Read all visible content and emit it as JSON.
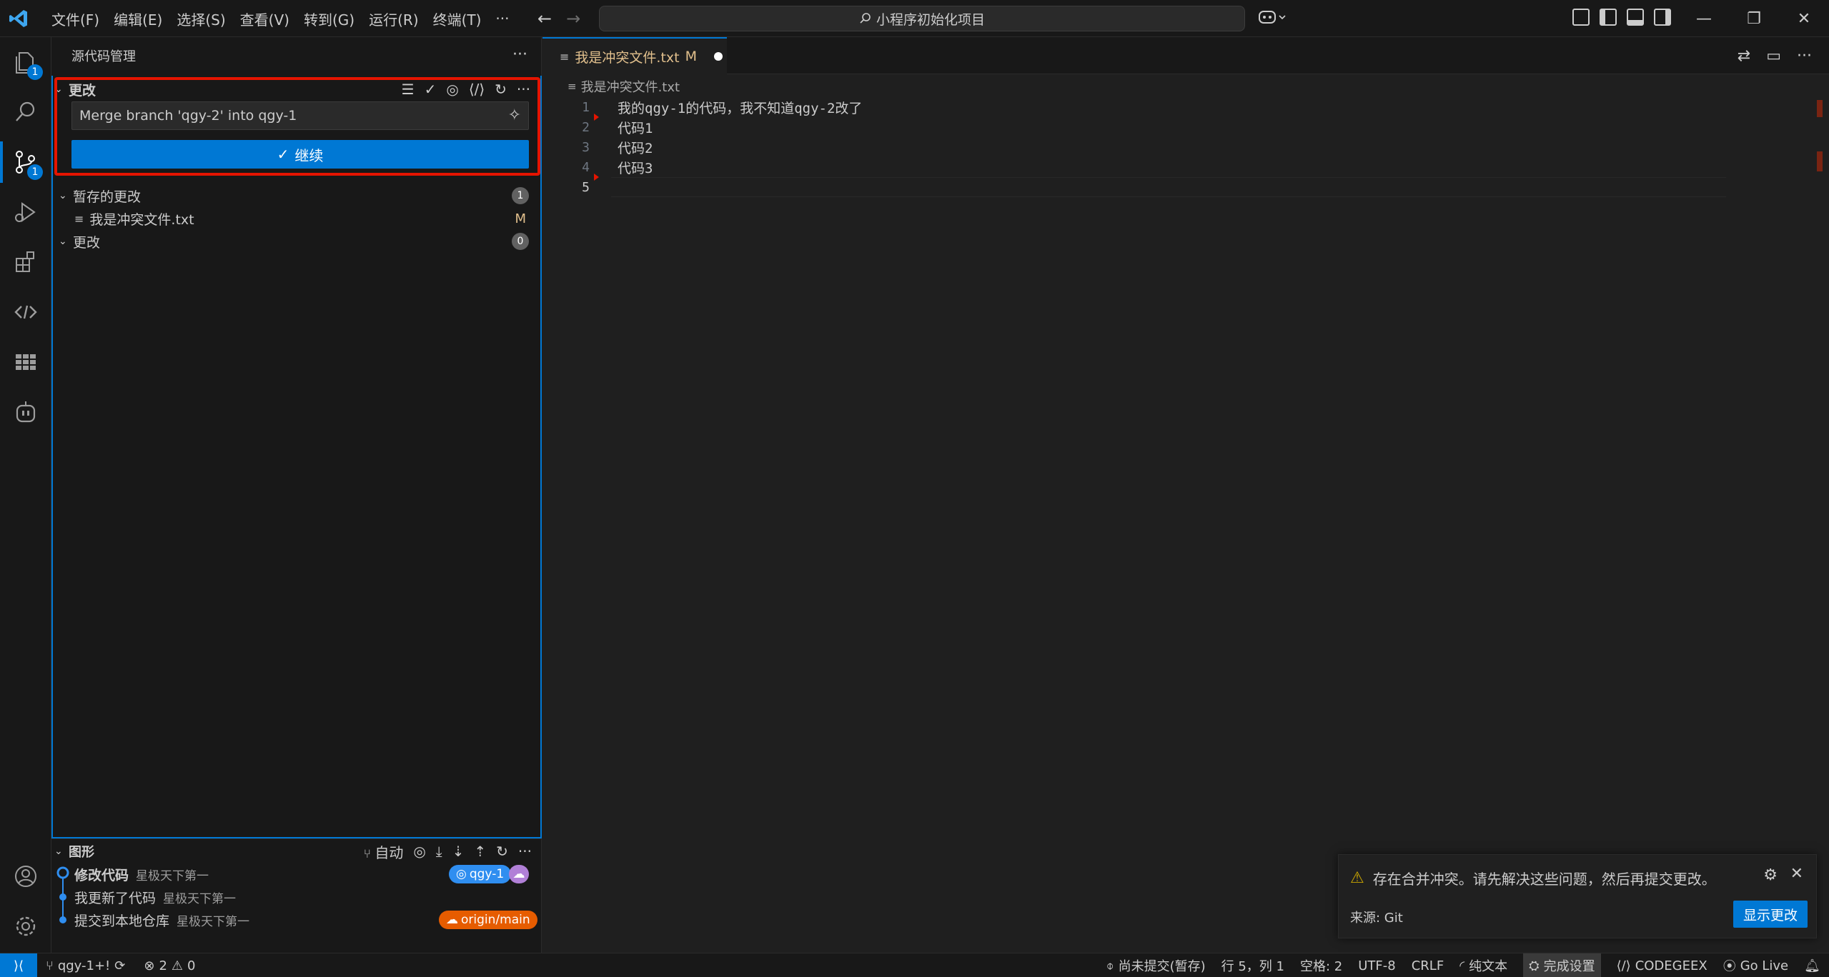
{
  "titlebar": {
    "menus": [
      "文件(F)",
      "编辑(E)",
      "选择(S)",
      "查看(V)",
      "转到(G)",
      "运行(R)",
      "终端(T)",
      "···"
    ],
    "search_text": "小程序初始化项目"
  },
  "activity": {
    "explorer_badge": "1",
    "scm_badge": "1"
  },
  "sidebar": {
    "header": "源代码管理",
    "changes_section": "更改",
    "commit_message": "Merge branch 'qgy-2' into qgy-1",
    "commit_button": "继续",
    "staged_label": "暂存的更改",
    "staged_count": "1",
    "staged_file": "我是冲突文件.txt",
    "staged_file_status": "M",
    "unstaged_label": "更改",
    "unstaged_count": "0"
  },
  "graph": {
    "header": "图形",
    "auto_label": "自动",
    "commits": [
      {
        "message": "修改代码",
        "author": "星极天下第一",
        "ref": "qgy-1"
      },
      {
        "message": "我更新了代码",
        "author": "星极天下第一"
      },
      {
        "message": "提交到本地仓库",
        "author": "星极天下第一",
        "ref": "origin/main"
      }
    ]
  },
  "editor": {
    "tab_label": "我是冲突文件.txt",
    "tab_status": "M",
    "breadcrumb": "我是冲突文件.txt",
    "lines": [
      {
        "num": "1",
        "text": "我的qgy-1的代码，我不知道qgy-2改了"
      },
      {
        "num": "2",
        "text": "代码1"
      },
      {
        "num": "3",
        "text": "代码2"
      },
      {
        "num": "4",
        "text": "代码3"
      },
      {
        "num": "5",
        "text": ""
      }
    ]
  },
  "notification": {
    "message": "存在合并冲突。请先解决这些问题，然后再提交更改。",
    "source": "来源: Git",
    "button": "显示更改"
  },
  "statusbar": {
    "branch": "qgy-1+!",
    "errors": "2",
    "warnings": "0",
    "uncommitted": "尚未提交(暂存)",
    "position": "行 5，列 1",
    "spaces": "空格: 2",
    "encoding": "UTF-8",
    "eol": "CRLF",
    "language": "纯文本",
    "copilot": "完成设置",
    "codegeex": "CODEGEEX",
    "golive": "Go Live"
  },
  "colors": {
    "accent": "#0078d4",
    "modified": "#e2c08d",
    "conflict_red": "#e51400",
    "qgy1_badge": "#2f8ef0",
    "origin_badge": "#e65c00",
    "cloud_badge": "#b180d7"
  }
}
